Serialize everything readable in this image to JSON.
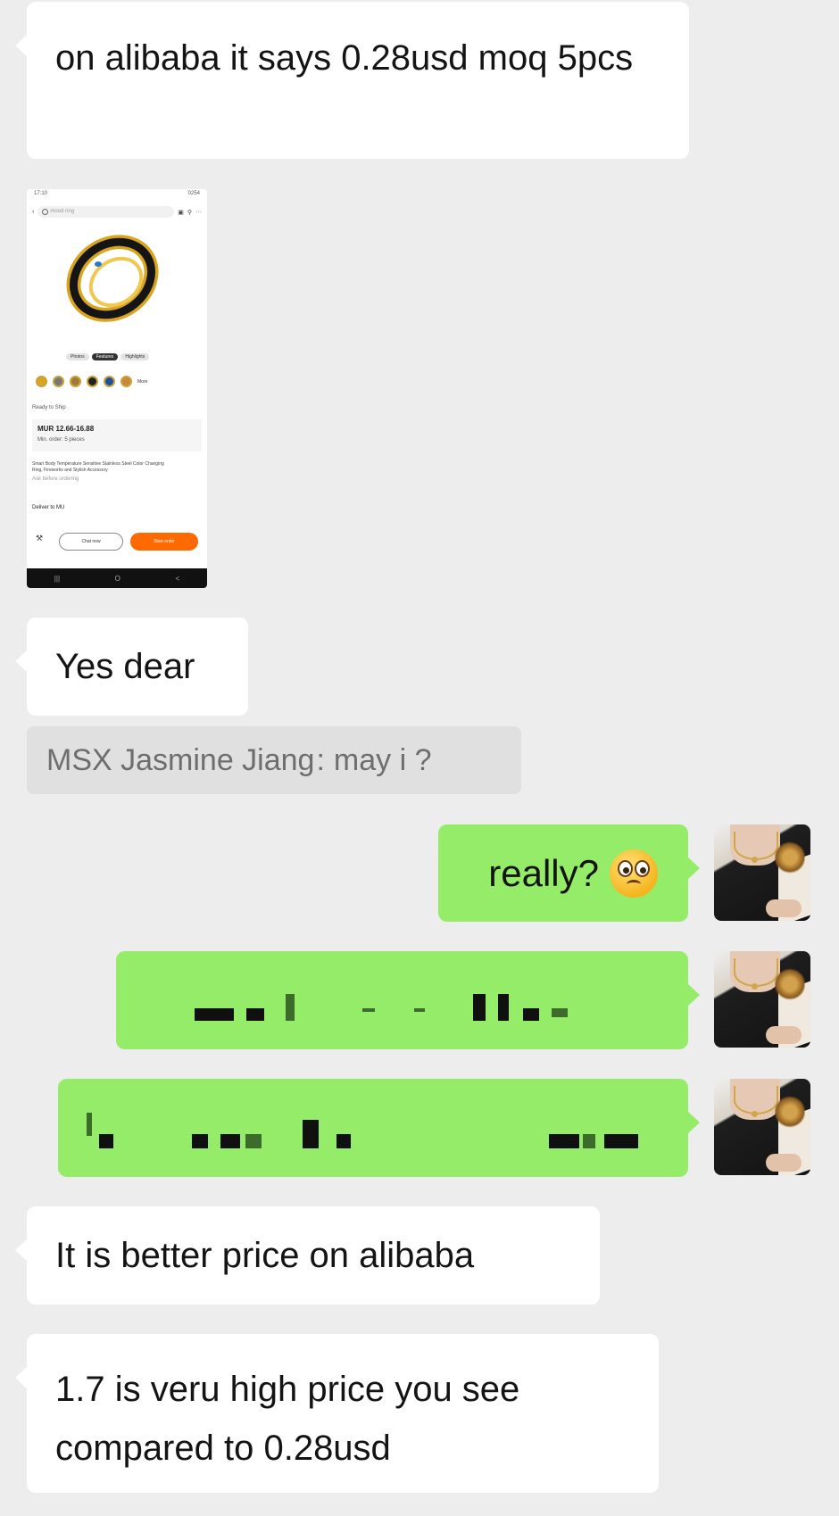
{
  "messages": {
    "m1": {
      "direction": "incoming",
      "text": "on alibaba it says 0.28usd moq 5pcs"
    },
    "m2": {
      "direction": "incoming",
      "text": "Yes dear"
    },
    "quote": {
      "sender": "MSX Jasmine Jiang",
      "separator": ":",
      "text": "may i ?"
    },
    "m3": {
      "direction": "outgoing",
      "text": "really?",
      "emoji": "flushed-face"
    },
    "m4": {
      "direction": "outgoing",
      "text": "",
      "redacted": true
    },
    "m5": {
      "direction": "outgoing",
      "text": "",
      "redacted": true
    },
    "m6": {
      "direction": "incoming",
      "text": "It is better price on alibaba"
    },
    "m7": {
      "direction": "incoming",
      "text": "1.7 is veru high price you see compared to 0.28usd"
    }
  },
  "screenshot": {
    "status_time": "17:10",
    "status_right": "0254",
    "search_placeholder": "mood ring",
    "tabs": [
      "Photos",
      "Features",
      "Highlights"
    ],
    "more": "More",
    "ready_to_ship": "Ready to Ship",
    "price": "MUR 12.66-16.88",
    "min_order": "Min. order: 5 pieces",
    "description": "Smart Body Temperature Sensitive Stainless Steel Color Changing Ring, Fireworks and Stylish Accessory",
    "sold": "Ask before ordering",
    "deliver": "Deliver to MU",
    "chat_now": "Chat now",
    "start_order": "Start order",
    "nav": [
      "|||",
      "O",
      "<"
    ]
  },
  "colors": {
    "background": "#ededed",
    "incoming_bubble": "#ffffff",
    "outgoing_bubble": "#95ec69",
    "quote_bg": "#e0e0e0",
    "quote_text": "#6e6e6e",
    "accent_orange": "#ff6a00"
  }
}
